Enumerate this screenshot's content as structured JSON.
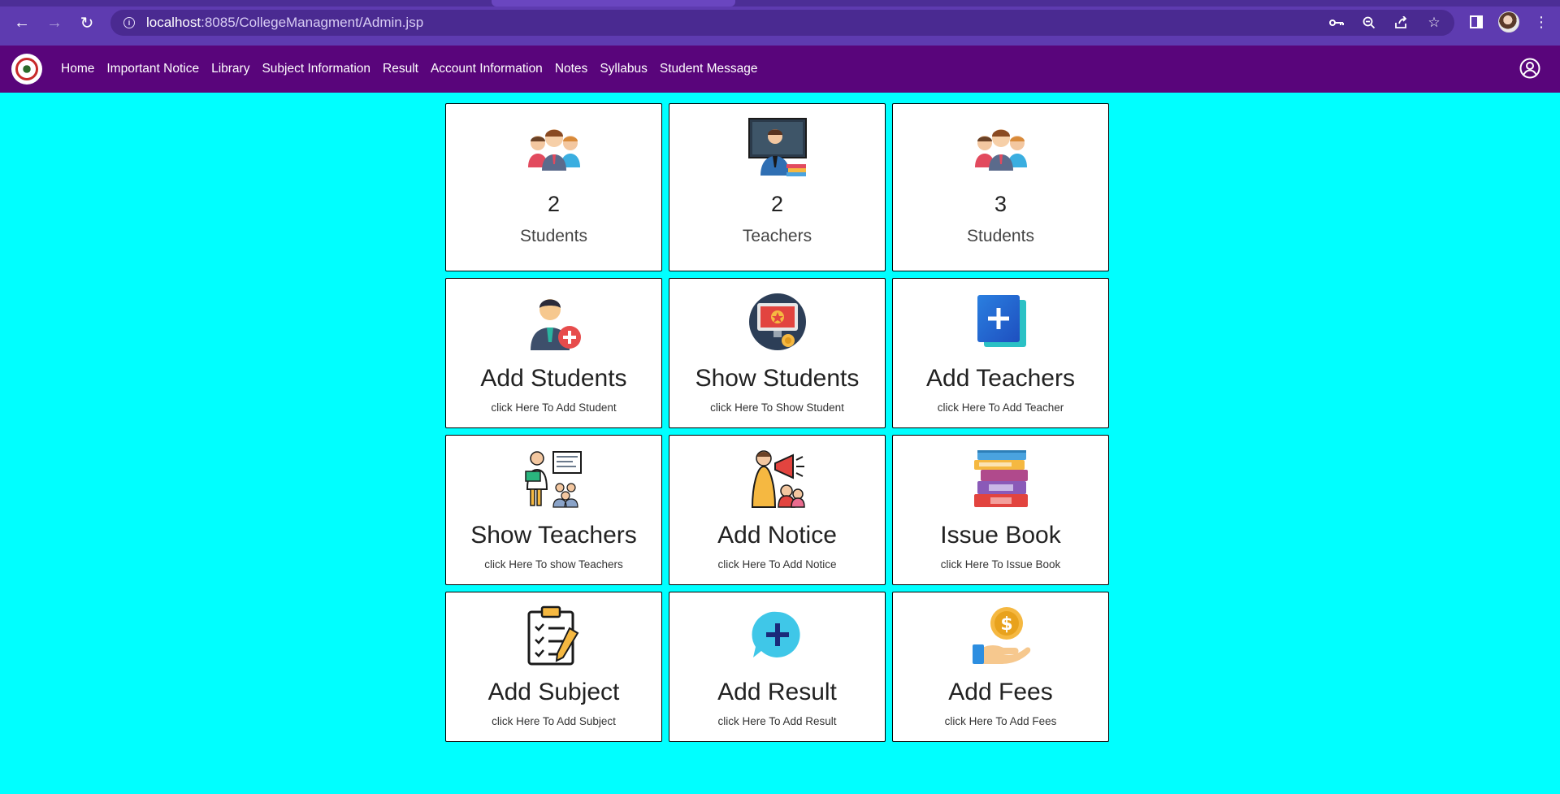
{
  "browser": {
    "url_host": "localhost",
    "url_rest": ":8085/CollegeManagment/Admin.jsp"
  },
  "navbar": {
    "links": [
      "Home",
      "Important Notice",
      "Library",
      "Subject Information",
      "Result",
      "Account Information",
      "Notes",
      "Syllabus",
      "Student Message"
    ]
  },
  "stats": [
    {
      "value": "2",
      "label": "Students",
      "icon": "group-icon"
    },
    {
      "value": "2",
      "label": "Teachers",
      "icon": "teacher-icon"
    },
    {
      "value": "3",
      "label": "Students",
      "icon": "group-icon"
    }
  ],
  "actions": [
    {
      "title": "Add Students",
      "subtitle": "click Here To Add Student",
      "icon": "add-user-icon"
    },
    {
      "title": "Show Students",
      "subtitle": "click Here To Show Student",
      "icon": "monitor-icon"
    },
    {
      "title": "Add Teachers",
      "subtitle": "click Here To Add Teacher",
      "icon": "add-square-icon"
    },
    {
      "title": "Show Teachers",
      "subtitle": "click Here To show Teachers",
      "icon": "classroom-icon"
    },
    {
      "title": "Add Notice",
      "subtitle": "click Here To Add Notice",
      "icon": "megaphone-icon"
    },
    {
      "title": "Issue Book",
      "subtitle": "click Here To Issue Book",
      "icon": "books-icon"
    },
    {
      "title": "Add Subject",
      "subtitle": "click Here To Add Subject",
      "icon": "clipboard-icon"
    },
    {
      "title": "Add Result",
      "subtitle": "click Here To Add Result",
      "icon": "add-bubble-icon"
    },
    {
      "title": "Add Fees",
      "subtitle": "click Here To Add Fees",
      "icon": "coin-hand-icon"
    }
  ],
  "colors": {
    "page_background": "#00ffff",
    "navbar_background": "#59057b",
    "browser_chrome": "#5e3bb0"
  }
}
